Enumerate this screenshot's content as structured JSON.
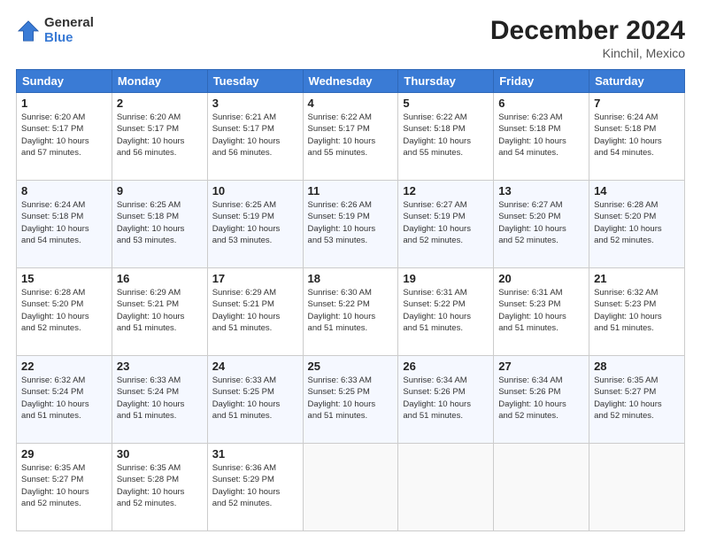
{
  "logo": {
    "general": "General",
    "blue": "Blue"
  },
  "header": {
    "month": "December 2024",
    "location": "Kinchil, Mexico"
  },
  "weekdays": [
    "Sunday",
    "Monday",
    "Tuesday",
    "Wednesday",
    "Thursday",
    "Friday",
    "Saturday"
  ],
  "weeks": [
    [
      {
        "day": "1",
        "info": "Sunrise: 6:20 AM\nSunset: 5:17 PM\nDaylight: 10 hours\nand 57 minutes."
      },
      {
        "day": "2",
        "info": "Sunrise: 6:20 AM\nSunset: 5:17 PM\nDaylight: 10 hours\nand 56 minutes."
      },
      {
        "day": "3",
        "info": "Sunrise: 6:21 AM\nSunset: 5:17 PM\nDaylight: 10 hours\nand 56 minutes."
      },
      {
        "day": "4",
        "info": "Sunrise: 6:22 AM\nSunset: 5:17 PM\nDaylight: 10 hours\nand 55 minutes."
      },
      {
        "day": "5",
        "info": "Sunrise: 6:22 AM\nSunset: 5:18 PM\nDaylight: 10 hours\nand 55 minutes."
      },
      {
        "day": "6",
        "info": "Sunrise: 6:23 AM\nSunset: 5:18 PM\nDaylight: 10 hours\nand 54 minutes."
      },
      {
        "day": "7",
        "info": "Sunrise: 6:24 AM\nSunset: 5:18 PM\nDaylight: 10 hours\nand 54 minutes."
      }
    ],
    [
      {
        "day": "8",
        "info": "Sunrise: 6:24 AM\nSunset: 5:18 PM\nDaylight: 10 hours\nand 54 minutes."
      },
      {
        "day": "9",
        "info": "Sunrise: 6:25 AM\nSunset: 5:18 PM\nDaylight: 10 hours\nand 53 minutes."
      },
      {
        "day": "10",
        "info": "Sunrise: 6:25 AM\nSunset: 5:19 PM\nDaylight: 10 hours\nand 53 minutes."
      },
      {
        "day": "11",
        "info": "Sunrise: 6:26 AM\nSunset: 5:19 PM\nDaylight: 10 hours\nand 53 minutes."
      },
      {
        "day": "12",
        "info": "Sunrise: 6:27 AM\nSunset: 5:19 PM\nDaylight: 10 hours\nand 52 minutes."
      },
      {
        "day": "13",
        "info": "Sunrise: 6:27 AM\nSunset: 5:20 PM\nDaylight: 10 hours\nand 52 minutes."
      },
      {
        "day": "14",
        "info": "Sunrise: 6:28 AM\nSunset: 5:20 PM\nDaylight: 10 hours\nand 52 minutes."
      }
    ],
    [
      {
        "day": "15",
        "info": "Sunrise: 6:28 AM\nSunset: 5:20 PM\nDaylight: 10 hours\nand 52 minutes."
      },
      {
        "day": "16",
        "info": "Sunrise: 6:29 AM\nSunset: 5:21 PM\nDaylight: 10 hours\nand 51 minutes."
      },
      {
        "day": "17",
        "info": "Sunrise: 6:29 AM\nSunset: 5:21 PM\nDaylight: 10 hours\nand 51 minutes."
      },
      {
        "day": "18",
        "info": "Sunrise: 6:30 AM\nSunset: 5:22 PM\nDaylight: 10 hours\nand 51 minutes."
      },
      {
        "day": "19",
        "info": "Sunrise: 6:31 AM\nSunset: 5:22 PM\nDaylight: 10 hours\nand 51 minutes."
      },
      {
        "day": "20",
        "info": "Sunrise: 6:31 AM\nSunset: 5:23 PM\nDaylight: 10 hours\nand 51 minutes."
      },
      {
        "day": "21",
        "info": "Sunrise: 6:32 AM\nSunset: 5:23 PM\nDaylight: 10 hours\nand 51 minutes."
      }
    ],
    [
      {
        "day": "22",
        "info": "Sunrise: 6:32 AM\nSunset: 5:24 PM\nDaylight: 10 hours\nand 51 minutes."
      },
      {
        "day": "23",
        "info": "Sunrise: 6:33 AM\nSunset: 5:24 PM\nDaylight: 10 hours\nand 51 minutes."
      },
      {
        "day": "24",
        "info": "Sunrise: 6:33 AM\nSunset: 5:25 PM\nDaylight: 10 hours\nand 51 minutes."
      },
      {
        "day": "25",
        "info": "Sunrise: 6:33 AM\nSunset: 5:25 PM\nDaylight: 10 hours\nand 51 minutes."
      },
      {
        "day": "26",
        "info": "Sunrise: 6:34 AM\nSunset: 5:26 PM\nDaylight: 10 hours\nand 51 minutes."
      },
      {
        "day": "27",
        "info": "Sunrise: 6:34 AM\nSunset: 5:26 PM\nDaylight: 10 hours\nand 52 minutes."
      },
      {
        "day": "28",
        "info": "Sunrise: 6:35 AM\nSunset: 5:27 PM\nDaylight: 10 hours\nand 52 minutes."
      }
    ],
    [
      {
        "day": "29",
        "info": "Sunrise: 6:35 AM\nSunset: 5:27 PM\nDaylight: 10 hours\nand 52 minutes."
      },
      {
        "day": "30",
        "info": "Sunrise: 6:35 AM\nSunset: 5:28 PM\nDaylight: 10 hours\nand 52 minutes."
      },
      {
        "day": "31",
        "info": "Sunrise: 6:36 AM\nSunset: 5:29 PM\nDaylight: 10 hours\nand 52 minutes."
      },
      null,
      null,
      null,
      null
    ]
  ]
}
